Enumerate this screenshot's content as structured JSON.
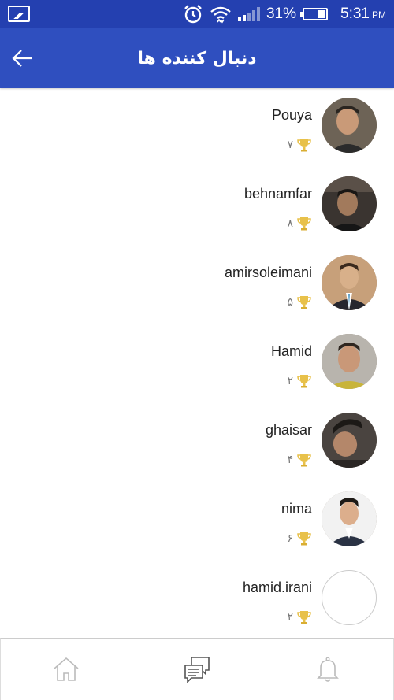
{
  "status_bar": {
    "battery_percent": "31%",
    "time": "5:31",
    "ampm": "PM",
    "icons": [
      "gallery-icon",
      "alarm-icon",
      "wifi-icon",
      "signal-icon",
      "battery-icon"
    ]
  },
  "header": {
    "title": "دنبال کننده ها",
    "back_icon": "arrow-left-icon",
    "color": "#2f4fbf"
  },
  "followers": [
    {
      "name": "Pouya",
      "score": "۷",
      "avatar": "photo"
    },
    {
      "name": "behnamfar",
      "score": "۸",
      "avatar": "photo"
    },
    {
      "name": "amirsoleimani",
      "score": "۵",
      "avatar": "photo"
    },
    {
      "name": "Hamid",
      "score": "۲",
      "avatar": "photo"
    },
    {
      "name": "ghaisar",
      "score": "۴",
      "avatar": "photo"
    },
    {
      "name": "nima",
      "score": "۶",
      "avatar": "photo"
    },
    {
      "name": "hamid.irani",
      "score": "۲",
      "avatar": "empty"
    }
  ],
  "bottom_nav": [
    {
      "icon": "home-icon"
    },
    {
      "icon": "chat-icon"
    },
    {
      "icon": "bell-icon"
    }
  ],
  "colors": {
    "status_bar": "#2440b0",
    "app_bar": "#2f4fbf",
    "trophy": "#e8c14a"
  }
}
